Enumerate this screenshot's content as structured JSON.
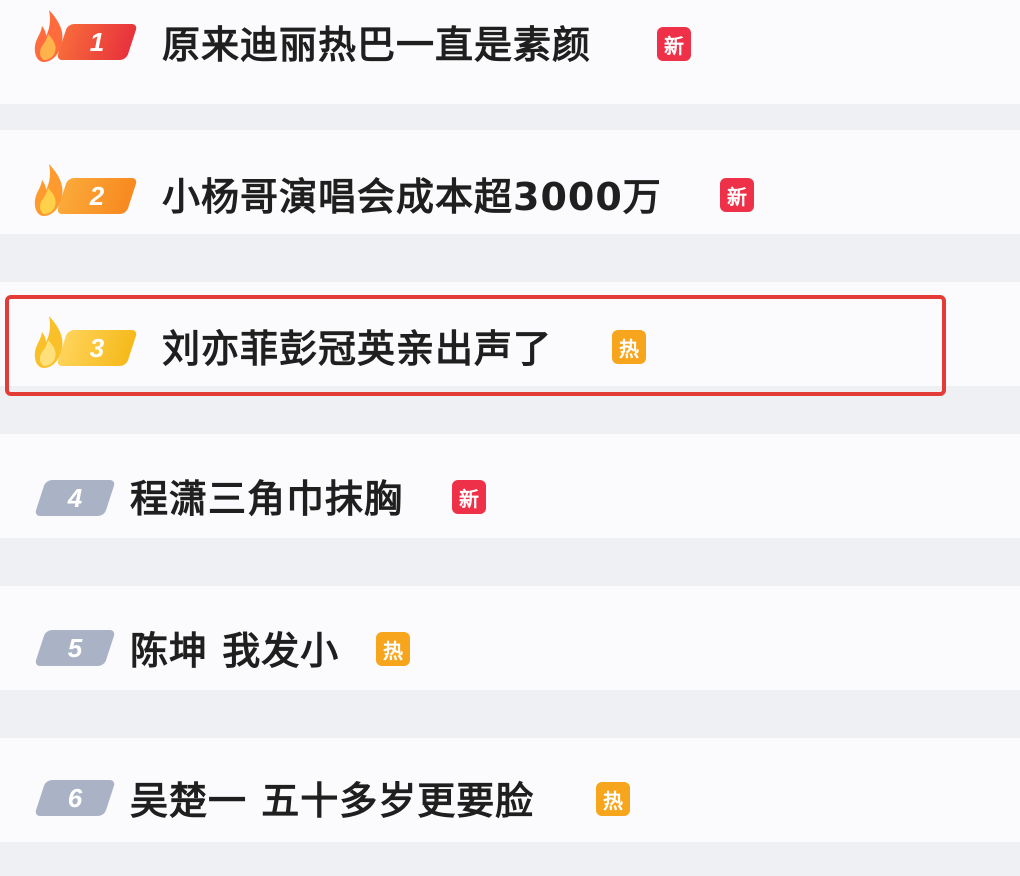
{
  "items": [
    {
      "rank": "1",
      "title": "原来迪丽热巴一直是素颜",
      "tag": "新"
    },
    {
      "rank": "2",
      "title": "小杨哥演唱会成本超3000万",
      "tag": "新"
    },
    {
      "rank": "3",
      "title": "刘亦菲彭冠英亲出声了",
      "tag": "热"
    },
    {
      "rank": "4",
      "title": "程潇三角巾抹胸",
      "tag": "新"
    },
    {
      "rank": "5",
      "title": "陈坤 我发小",
      "tag": "热"
    },
    {
      "rank": "6",
      "title": "吴楚一 五十多岁更要脸",
      "tag": "热"
    }
  ],
  "colors": {
    "rank1": "#e8323c",
    "rank2": "#f7891f",
    "rank3": "#f5b91a",
    "rank_other": "#aab3c6",
    "tag_new": "#ee3148",
    "tag_hot": "#f7a51c",
    "highlight": "#e23b38"
  },
  "icons": {
    "top_rank": "flame-icon"
  }
}
